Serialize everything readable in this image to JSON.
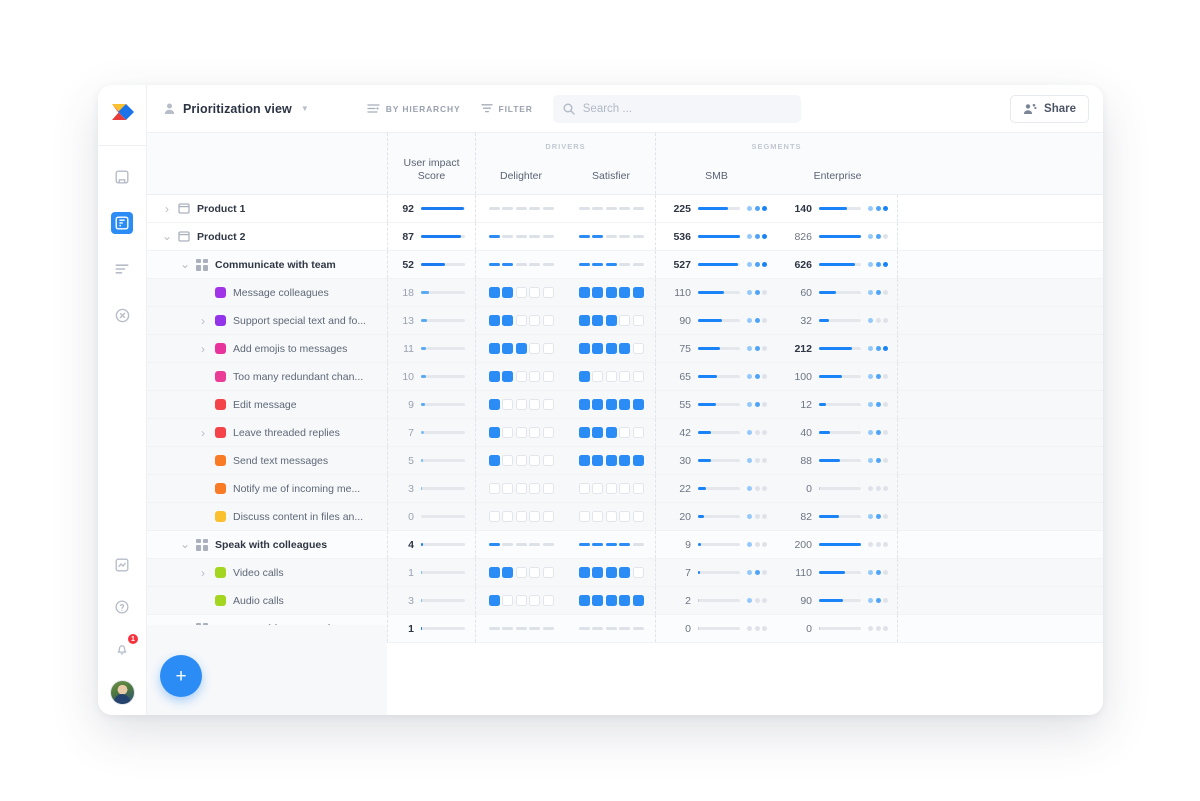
{
  "app": {
    "logo_icon": "productboard-logo",
    "view_name": "Prioritization view",
    "view_user_icon": "person-icon",
    "view_caret_icon": "chevron-down-icon"
  },
  "toolbar": {
    "hierarchy_label": "BY HIERARCHY",
    "hierarchy_icon": "hierarchy-icon",
    "filter_label": "FILTER",
    "filter_icon": "filter-icon",
    "search_placeholder": "Search ...",
    "search_value": "",
    "search_icon": "search-icon",
    "share_label": "Share",
    "share_icon": "share-person-icon"
  },
  "rail": {
    "items": [
      {
        "name": "board-icon",
        "active": false
      },
      {
        "name": "features-icon",
        "active": true
      },
      {
        "name": "roadmap-icon",
        "active": false
      },
      {
        "name": "insights-icon",
        "active": false
      }
    ],
    "bottom": [
      {
        "name": "reports-icon"
      },
      {
        "name": "help-icon"
      },
      {
        "name": "notifications-icon",
        "badge": "1"
      },
      {
        "name": "user-avatar"
      }
    ],
    "badge_color": "#f5333f",
    "active_color": "#2b8cf5"
  },
  "fab": {
    "label": "+",
    "color": "#2b8cf5"
  },
  "table": {
    "groups": [
      {
        "label": "DRIVERS",
        "span": 2
      },
      {
        "label": "SEGMENTS",
        "span": 2
      }
    ],
    "columns": {
      "tree": "",
      "score": "User impact\nScore",
      "score_line1": "User impact",
      "score_line2": "Score",
      "delighter": "Delighter",
      "satisfier": "Satisfier",
      "smb": "SMB",
      "enterprise": "Enterprise"
    },
    "score_max": 95,
    "smb_max": 560,
    "ent_max": 850,
    "rows": [
      {
        "label": "Product 1",
        "level": 0,
        "shade": 0,
        "bold": true,
        "icon": "product-icon",
        "twisty": "collapsed",
        "score": 92,
        "score_tone": "dark",
        "delighter": {
          "style": "dash",
          "filled": 0
        },
        "satisfier": {
          "style": "dash",
          "filled": 0
        },
        "smb": {
          "value": 225,
          "bar": 0.72,
          "dots": 3
        },
        "ent": {
          "value": 140,
          "bar": 0.66,
          "dots": 3
        }
      },
      {
        "label": "Product 2",
        "level": 0,
        "shade": 0,
        "bold": true,
        "icon": "product-icon",
        "twisty": "expanded",
        "score": 87,
        "score_tone": "dark",
        "delighter": {
          "style": "dash",
          "filled": 1
        },
        "satisfier": {
          "style": "dash",
          "filled": 2
        },
        "smb": {
          "value": 536,
          "bar": 1.0,
          "dots": 3
        },
        "ent": {
          "value": 826,
          "bar": 1.0,
          "dots": 2
        }
      },
      {
        "label": "Communicate with team",
        "level": 1,
        "shade": 1,
        "bold": true,
        "icon": "component-icon",
        "twisty": "expanded",
        "score": 52,
        "score_tone": "dark",
        "delighter": {
          "style": "dash",
          "filled": 2
        },
        "satisfier": {
          "style": "dash",
          "filled": 3
        },
        "smb": {
          "value": 527,
          "bar": 0.95,
          "dots": 3
        },
        "ent": {
          "value": 626,
          "bar": 0.86,
          "dots": 3
        }
      },
      {
        "label": "Message colleagues",
        "level": 2,
        "shade": 2,
        "bold": false,
        "icon": "swatch",
        "color": "#a234e8",
        "twisty": "none",
        "score": 18,
        "score_tone": "dim",
        "delighter": {
          "style": "block",
          "filled": 2
        },
        "satisfier": {
          "style": "block",
          "filled": 5
        },
        "smb": {
          "value": 110,
          "bar": 0.62,
          "dots": 2
        },
        "ent": {
          "value": 60,
          "bar": 0.4,
          "dots": 2
        }
      },
      {
        "label": "Support special text and fo...",
        "level": 2,
        "shade": 2,
        "bold": false,
        "icon": "swatch",
        "color": "#9333ea",
        "twisty": "collapsed",
        "score": 13,
        "score_tone": "dim",
        "delighter": {
          "style": "block",
          "filled": 2
        },
        "satisfier": {
          "style": "block",
          "filled": 3
        },
        "smb": {
          "value": 90,
          "bar": 0.58,
          "dots": 2
        },
        "ent": {
          "value": 32,
          "bar": 0.24,
          "dots": 1
        }
      },
      {
        "label": "Add emojis to messages",
        "level": 2,
        "shade": 2,
        "bold": false,
        "icon": "swatch",
        "color": "#e8329c",
        "twisty": "collapsed",
        "score": 11,
        "score_tone": "dim",
        "delighter": {
          "style": "block",
          "filled": 3
        },
        "satisfier": {
          "style": "block",
          "filled": 4
        },
        "smb": {
          "value": 75,
          "bar": 0.52,
          "dots": 2
        },
        "ent": {
          "value": 212,
          "bar": 0.78,
          "dots": 3
        }
      },
      {
        "label": "Too many redundant chan...",
        "level": 2,
        "shade": 2,
        "bold": false,
        "icon": "swatch",
        "color": "#ec3d96",
        "twisty": "none",
        "score": 10,
        "score_tone": "dim",
        "delighter": {
          "style": "block",
          "filled": 2
        },
        "satisfier": {
          "style": "block",
          "filled": 1
        },
        "smb": {
          "value": 65,
          "bar": 0.46,
          "dots": 2
        },
        "ent": {
          "value": 100,
          "bar": 0.54,
          "dots": 2
        }
      },
      {
        "label": "Edit message",
        "level": 2,
        "shade": 2,
        "bold": false,
        "icon": "swatch",
        "color": "#f5434a",
        "twisty": "none",
        "score": 9,
        "score_tone": "dim",
        "delighter": {
          "style": "block",
          "filled": 1
        },
        "satisfier": {
          "style": "block",
          "filled": 5
        },
        "smb": {
          "value": 55,
          "bar": 0.42,
          "dots": 2
        },
        "ent": {
          "value": 12,
          "bar": 0.16,
          "dots": 2
        }
      },
      {
        "label": "Leave threaded replies",
        "level": 2,
        "shade": 2,
        "bold": false,
        "icon": "swatch",
        "color": "#f5434a",
        "twisty": "collapsed",
        "score": 7,
        "score_tone": "dim",
        "delighter": {
          "style": "block",
          "filled": 1
        },
        "satisfier": {
          "style": "block",
          "filled": 3
        },
        "smb": {
          "value": 42,
          "bar": 0.32,
          "dots": 1
        },
        "ent": {
          "value": 40,
          "bar": 0.26,
          "dots": 2
        }
      },
      {
        "label": "Send text messages",
        "level": 2,
        "shade": 2,
        "bold": false,
        "icon": "swatch",
        "color": "#f97b26",
        "twisty": "none",
        "score": 5,
        "score_tone": "dim",
        "delighter": {
          "style": "block",
          "filled": 1
        },
        "satisfier": {
          "style": "block",
          "filled": 5
        },
        "smb": {
          "value": 30,
          "bar": 0.3,
          "dots": 1
        },
        "ent": {
          "value": 88,
          "bar": 0.5,
          "dots": 2
        }
      },
      {
        "label": "Notify me of incoming me...",
        "level": 2,
        "shade": 2,
        "bold": false,
        "icon": "swatch",
        "color": "#f97b26",
        "twisty": "none",
        "score": 3,
        "score_tone": "dim",
        "delighter": {
          "style": "block",
          "filled": 0
        },
        "satisfier": {
          "style": "block",
          "filled": 0
        },
        "smb": {
          "value": 22,
          "bar": 0.18,
          "dots": 1
        },
        "ent": {
          "value": 0,
          "bar": 0.02,
          "dots": 0
        }
      },
      {
        "label": "Discuss content in files an...",
        "level": 2,
        "shade": 2,
        "bold": false,
        "icon": "swatch",
        "color": "#fbc02d",
        "twisty": "none",
        "score": 0,
        "score_tone": "dim",
        "delighter": {
          "style": "block",
          "filled": 0
        },
        "satisfier": {
          "style": "block",
          "filled": 0
        },
        "smb": {
          "value": 20,
          "bar": 0.15,
          "dots": 1
        },
        "ent": {
          "value": 82,
          "bar": 0.48,
          "dots": 2
        }
      },
      {
        "label": "Speak with colleagues",
        "level": 1,
        "shade": 1,
        "bold": true,
        "icon": "component-icon",
        "twisty": "expanded",
        "score": 4,
        "score_tone": "dark",
        "delighter": {
          "style": "dash",
          "filled": 1
        },
        "satisfier": {
          "style": "dash",
          "filled": 4
        },
        "smb": {
          "value": 9,
          "bar": 0.08,
          "dots": 1
        },
        "ent": {
          "value": 200,
          "bar": 1.0,
          "dots": 0
        }
      },
      {
        "label": "Video calls",
        "level": 2,
        "shade": 2,
        "bold": false,
        "icon": "swatch",
        "color": "#a4d521",
        "twisty": "collapsed",
        "score": 1,
        "score_tone": "dim",
        "delighter": {
          "style": "block",
          "filled": 2
        },
        "satisfier": {
          "style": "block",
          "filled": 4
        },
        "smb": {
          "value": 7,
          "bar": 0.05,
          "dots": 2
        },
        "ent": {
          "value": 110,
          "bar": 0.62,
          "dots": 2
        }
      },
      {
        "label": "Audio calls",
        "level": 2,
        "shade": 2,
        "bold": false,
        "icon": "swatch",
        "color": "#a4d521",
        "twisty": "none",
        "score": 3,
        "score_tone": "dim",
        "delighter": {
          "style": "block",
          "filled": 1
        },
        "satisfier": {
          "style": "block",
          "filled": 5
        },
        "smb": {
          "value": 2,
          "bar": 0.03,
          "dots": 1
        },
        "ent": {
          "value": 90,
          "bar": 0.58,
          "dots": 2
        }
      },
      {
        "label": "Connect with community",
        "level": 1,
        "shade": 1,
        "bold": true,
        "icon": "component-icon",
        "twisty": "collapsed",
        "score": 1,
        "score_tone": "dark",
        "delighter": {
          "style": "dash",
          "filled": 0
        },
        "satisfier": {
          "style": "dash",
          "filled": 0
        },
        "smb": {
          "value": 0,
          "bar": 0.02,
          "dots": 0
        },
        "ent": {
          "value": 0,
          "bar": 0.02,
          "dots": 0
        }
      }
    ]
  }
}
